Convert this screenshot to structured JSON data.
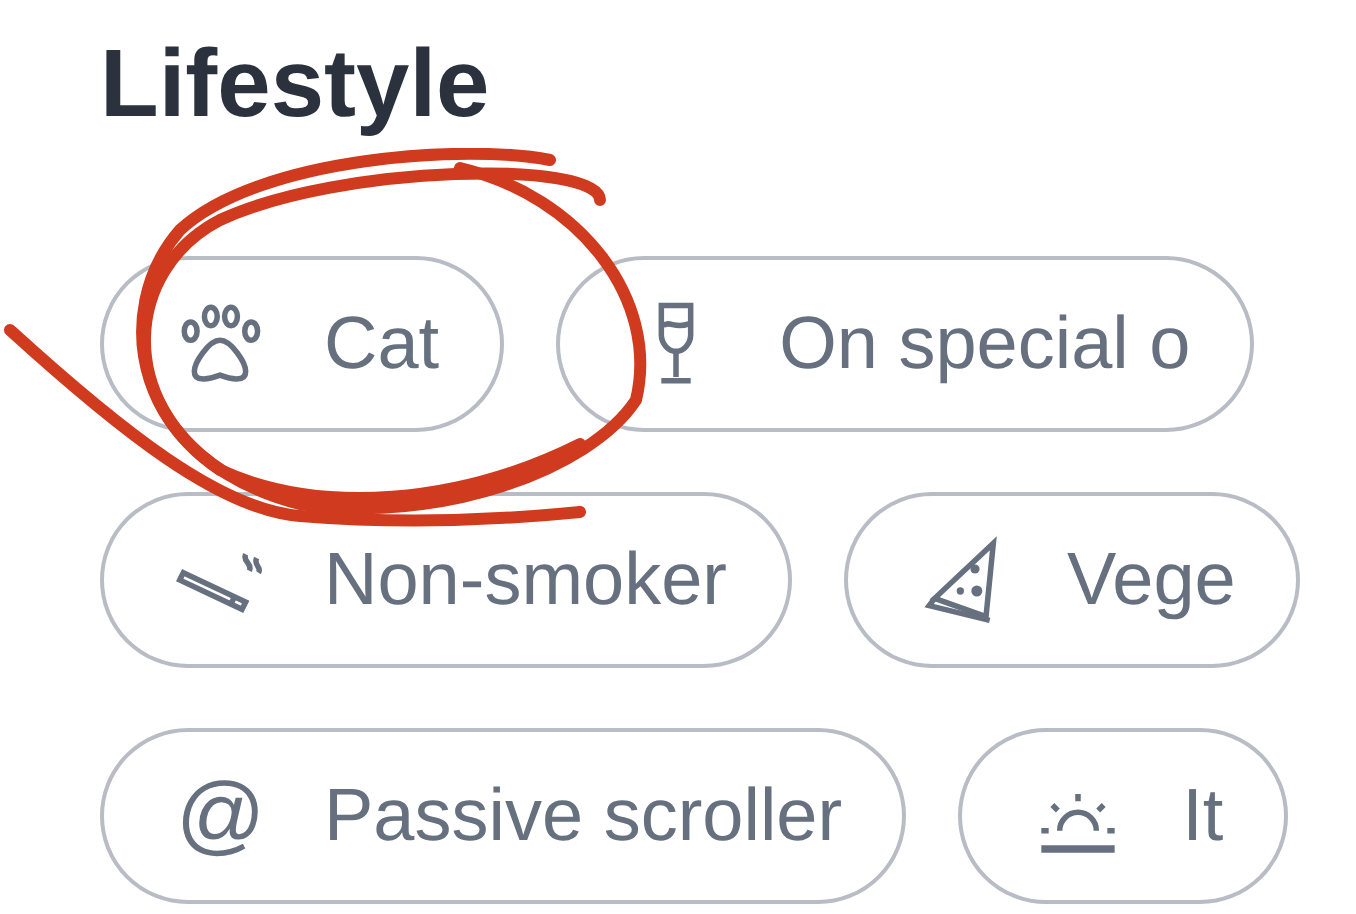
{
  "section": {
    "title": "Lifestyle"
  },
  "rows": [
    [
      {
        "label": "Cat",
        "kind": "paw"
      },
      {
        "label": "On special o",
        "kind": "glass"
      }
    ],
    [
      {
        "label": "Non-smoker",
        "kind": "cigarette"
      },
      {
        "label": "Vege",
        "kind": "pizza"
      }
    ],
    [
      {
        "label": "Passive scroller",
        "kind": "at",
        "icon_text": "@"
      },
      {
        "label": "It",
        "kind": "sunrise"
      }
    ]
  ]
}
